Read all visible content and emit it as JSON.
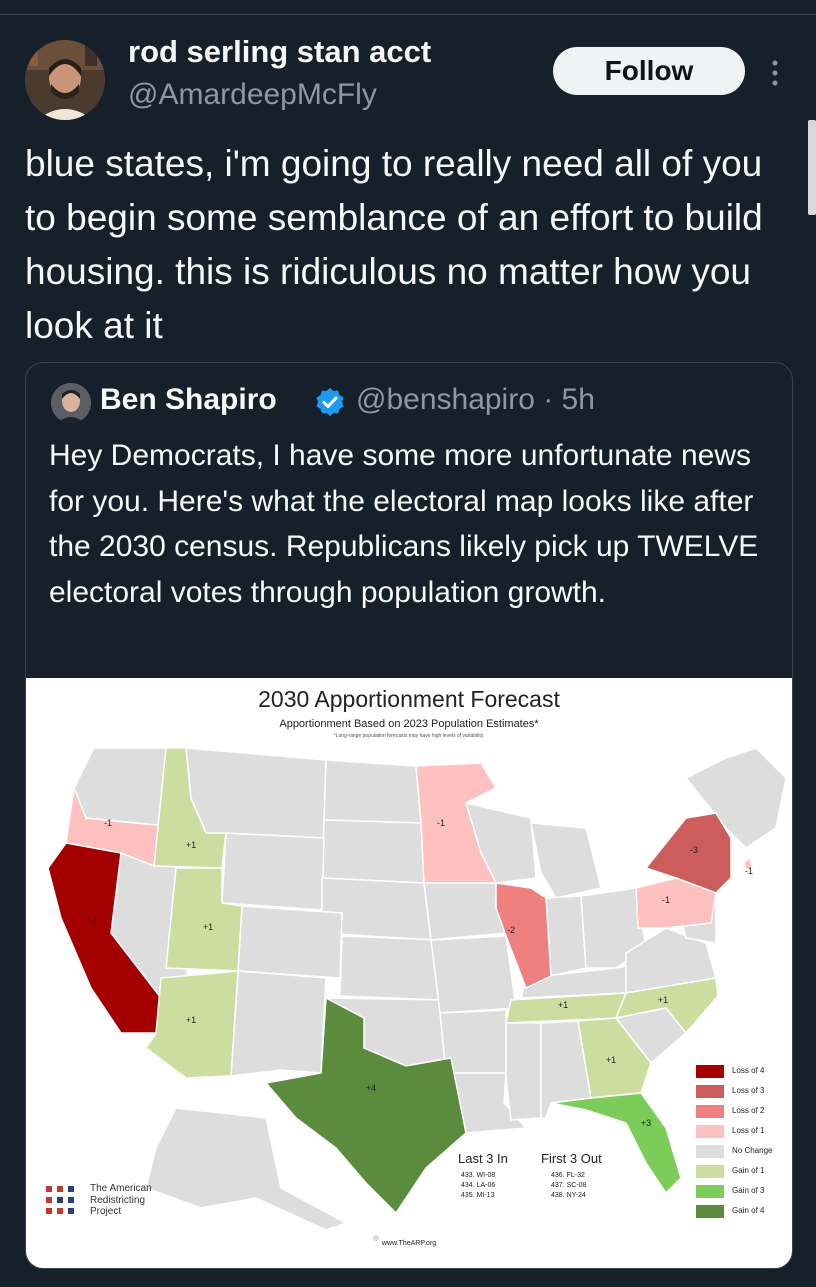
{
  "author": {
    "name": "rod serling stan acct",
    "handle": "@AmardeepMcFly",
    "follow_label": "Follow"
  },
  "tweet": {
    "text": "blue states, i'm going to really need all of you to begin some semblance of an effort to build housing. this is ridiculous no matter how you look at it"
  },
  "quoted": {
    "name": "Ben Shapiro",
    "handle_time": "@benshapiro · 5h",
    "text": "Hey Democrats, I have some more unfortunate news for you. Here's what the electoral map looks like after the 2030 census. Republicans likely pick up TWELVE electoral votes through population growth."
  },
  "map": {
    "title": "2030 Apportionment Forecast",
    "subtitle": "Apportionment Based on 2023 Population Estimates*",
    "footnote": "*Long-range population forecasts may have high levels of variability.",
    "state_changes": {
      "CA": "-4",
      "OR": "-1",
      "ID": "+1",
      "UT": "+1",
      "AZ": "+1",
      "TX": "+4",
      "MN": "-1",
      "IL": "-2",
      "NY": "-3",
      "PA": "-1",
      "RI": "-1",
      "TN": "+1",
      "NC": "+1",
      "GA": "+1",
      "FL": "+3"
    },
    "legend": [
      {
        "label": "Loss of 4",
        "color": "#a50000"
      },
      {
        "label": "Loss of 3",
        "color": "#cd5c5c"
      },
      {
        "label": "Loss of 2",
        "color": "#f08080"
      },
      {
        "label": "Loss of 1",
        "color": "#ffc0c0"
      },
      {
        "label": "No Change",
        "color": "#dddddd"
      },
      {
        "label": "Gain of 1",
        "color": "#ccdd9f"
      },
      {
        "label": "Gain of 3",
        "color": "#7ccc5a"
      },
      {
        "label": "Gain of 4",
        "color": "#5b8c3e"
      }
    ],
    "last3": {
      "heading": "Last 3 In",
      "items": [
        "433. WI-08",
        "434. LA-06",
        "435. MI-13"
      ]
    },
    "first3": {
      "heading": "First 3 Out",
      "items": [
        "436. FL-32",
        "437. SC-08",
        "438. NY-24"
      ]
    },
    "org": [
      "The American",
      "Redistricting",
      "Project"
    ],
    "website": "www.TheARP.org"
  }
}
